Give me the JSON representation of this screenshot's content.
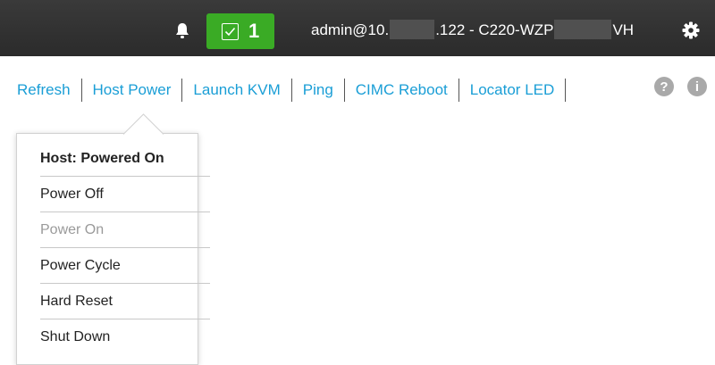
{
  "header": {
    "alarm_count": "1",
    "user_prefix": "admin@10.",
    "user_middle": ".122 - C220-WZP",
    "user_suffix": "VH",
    "bell_icon": "bell-icon",
    "gear_icon": "gear-icon",
    "alarm_icon": "checkbox-icon",
    "colors": {
      "bar": "#2e2e2e",
      "alarm": "#3aab25"
    }
  },
  "toolbar": {
    "items": [
      "Refresh",
      "Host Power",
      "Launch KVM",
      "Ping",
      "CIMC Reboot",
      "Locator LED"
    ],
    "help_icon": "help-icon",
    "info_icon": "info-icon",
    "link_color": "#1a9ed6"
  },
  "host_power_menu": {
    "header": "Host: Powered On",
    "items": [
      {
        "label": "Power Off",
        "enabled": true
      },
      {
        "label": "Power On",
        "enabled": false
      },
      {
        "label": "Power Cycle",
        "enabled": true
      },
      {
        "label": "Hard Reset",
        "enabled": true
      },
      {
        "label": "Shut Down",
        "enabled": true
      }
    ]
  }
}
